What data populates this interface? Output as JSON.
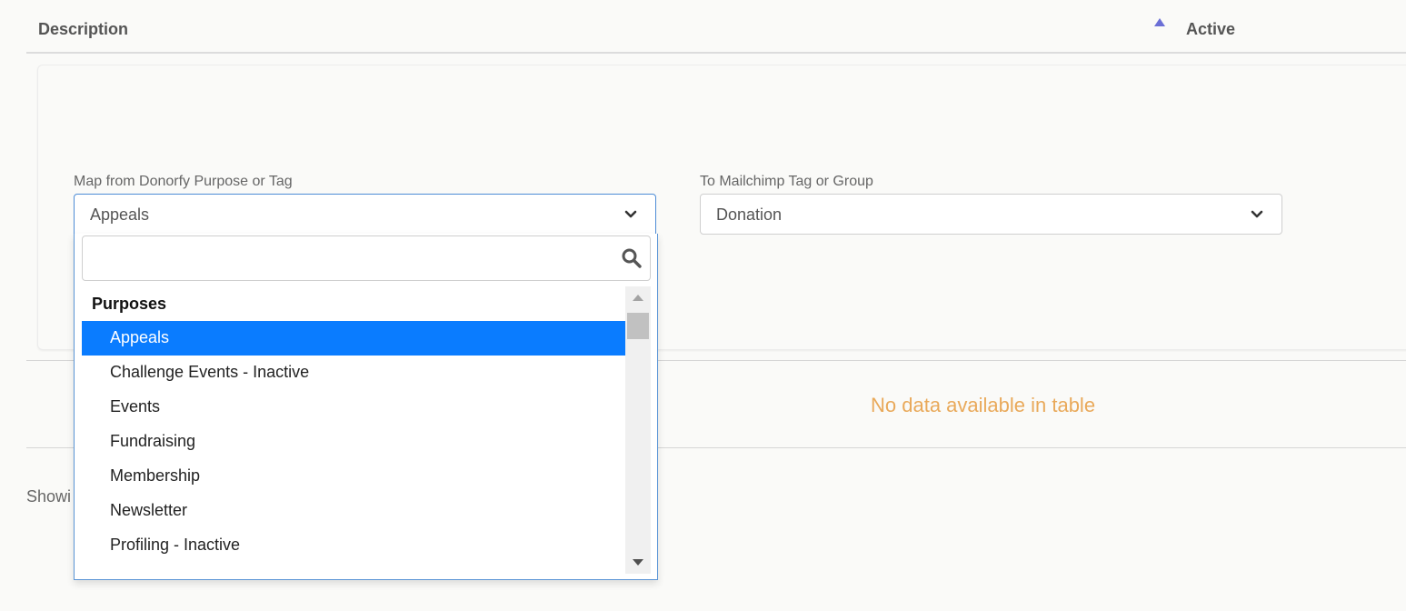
{
  "table": {
    "columns": [
      "Description",
      "Active"
    ],
    "empty_message": "No data available in table",
    "footer_info": "Showi"
  },
  "form": {
    "from": {
      "label": "Map from Donorfy Purpose or Tag",
      "value": "Appeals"
    },
    "to": {
      "label": "To Mailchimp Tag or Group",
      "value": "Donation"
    }
  },
  "dropdown": {
    "search_value": "",
    "group_label": "Purposes",
    "options": [
      "Appeals",
      "Challenge Events - Inactive",
      "Events",
      "Fundraising",
      "Membership",
      "Newsletter",
      "Profiling - Inactive"
    ],
    "selected_index": 0
  },
  "colors": {
    "selected_bg": "#0a7cff",
    "empty_message": "#e9a95a",
    "sort_arrow": "#6b6fd6"
  },
  "icons": {
    "sort": "sort-ascending-icon",
    "chevron": "chevron-down-icon",
    "search": "search-icon"
  }
}
